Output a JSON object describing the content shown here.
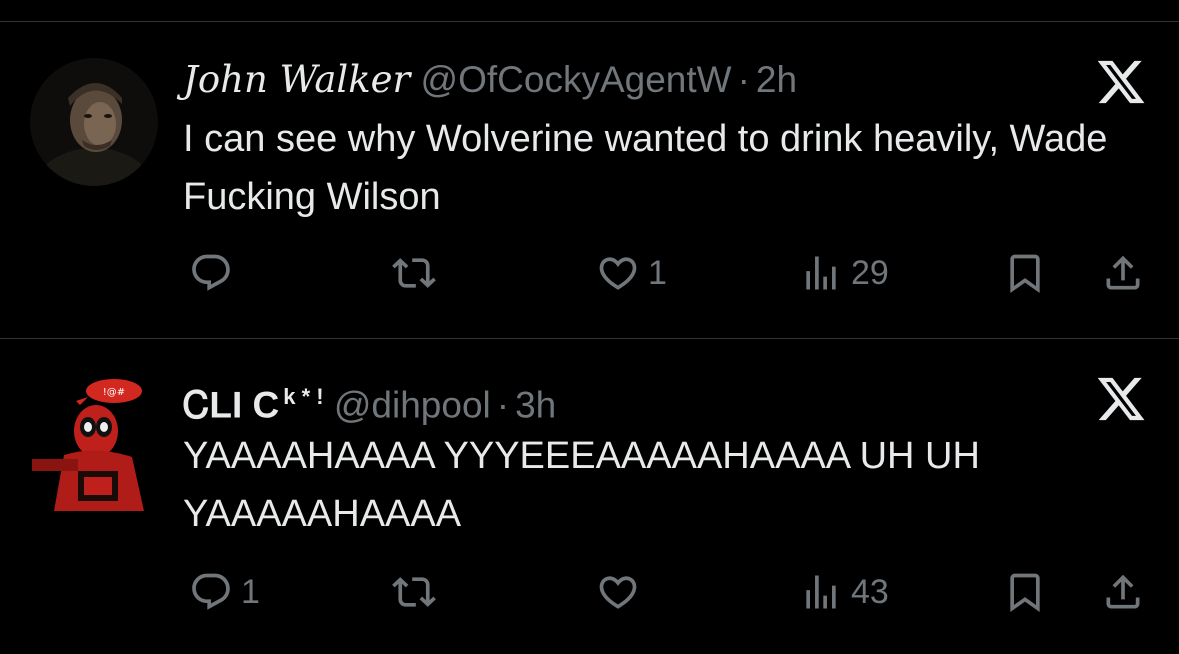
{
  "tweets": [
    {
      "name": "John Walker",
      "handle": "@OfCockyAgentW",
      "separator": "·",
      "time": "2h",
      "text": "I can see why Wolverine wanted to drink heavily, Wade Fucking Wilson",
      "reply_count": "",
      "like_count": "1",
      "view_count": "29",
      "avatar": "man-portrait-dark"
    },
    {
      "name": "ᏟLI C",
      "name_sup": "k * !",
      "handle": "@dihpool",
      "separator": "·",
      "time": "3h",
      "text": "YAAAAHAAAA YYYEEEAAAAAHAAAA UH UH YAAAAAHAAAA",
      "reply_count": "1",
      "like_count": "",
      "view_count": "43",
      "avatar": "deadpool-character"
    }
  ],
  "icons": {
    "brand": "x-logo-icon",
    "reply": "reply-icon",
    "repost": "repost-icon",
    "like": "heart-icon",
    "views": "views-chart-icon",
    "bookmark": "bookmark-icon",
    "share": "share-icon"
  },
  "colors": {
    "background": "#000000",
    "text": "#e7e9ea",
    "muted": "#71767b",
    "divider": "#2f3336"
  }
}
